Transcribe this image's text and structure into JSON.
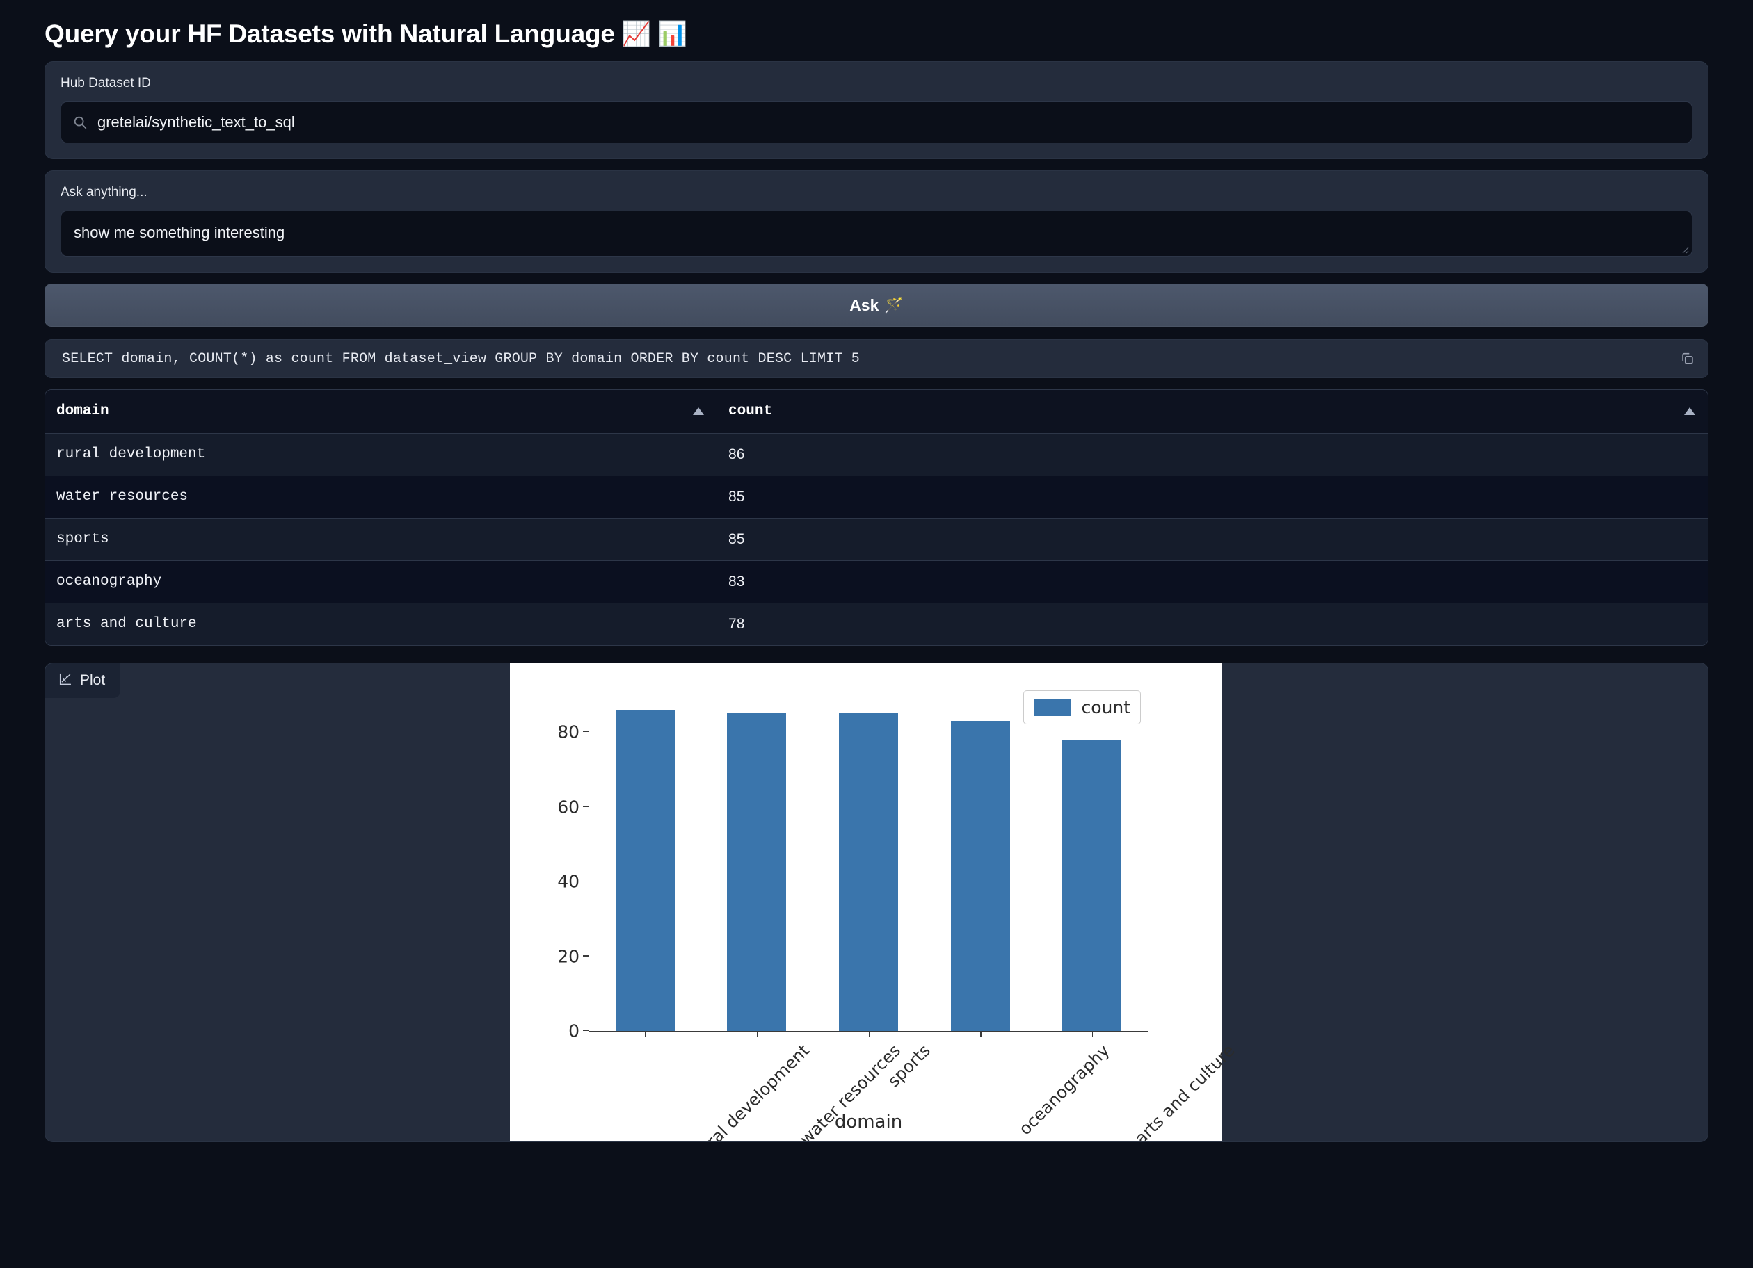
{
  "header": {
    "title": "Query your HF Datasets with Natural Language",
    "emoji_chart_increasing": "📈",
    "emoji_bar_chart": "📊"
  },
  "dataset_field": {
    "label": "Hub Dataset ID",
    "value": "gretelai/synthetic_text_to_sql",
    "placeholder": "Hub Dataset ID",
    "icon": "search-icon"
  },
  "query_field": {
    "label": "Ask anything...",
    "value": "show me something interesting",
    "placeholder": "Ask anything..."
  },
  "ask_button": {
    "label": "Ask",
    "emoji": "🪄"
  },
  "sql": {
    "text": "SELECT domain, COUNT(*) as count FROM dataset_view GROUP BY domain ORDER BY count DESC LIMIT 5",
    "copy_icon": "copy-icon"
  },
  "table": {
    "columns": [
      {
        "label": "domain",
        "sort": "ascending"
      },
      {
        "label": "count",
        "sort": "ascending"
      }
    ],
    "rows": [
      {
        "domain": "rural development",
        "count": "86"
      },
      {
        "domain": "water resources",
        "count": "85"
      },
      {
        "domain": "sports",
        "count": "85"
      },
      {
        "domain": "oceanography",
        "count": "83"
      },
      {
        "domain": "arts and culture",
        "count": "78"
      }
    ]
  },
  "plot_panel": {
    "tab_label": "Plot",
    "tab_icon": "plot-icon"
  },
  "colors": {
    "page_background": "#0b0f19",
    "panel_background": "#242c3c",
    "input_background": "#0b0f19",
    "bar_blue": "#3a75ac",
    "button_gradient_top": "#4d586c",
    "button_gradient_bottom": "#424c5e",
    "row_odd": "#151c2b",
    "row_even": "#0b1020"
  },
  "chart_data": {
    "type": "bar",
    "title": "",
    "categories": [
      "rural development",
      "water resources",
      "sports",
      "oceanography",
      "arts and culture"
    ],
    "values": [
      86,
      85,
      85,
      83,
      78
    ],
    "series": [
      {
        "name": "count",
        "values": [
          86,
          85,
          85,
          83,
          78
        ]
      }
    ],
    "xlabel": "domain",
    "ylabel": "",
    "ylim": [
      0,
      93
    ],
    "yticks": [
      0,
      20,
      40,
      60,
      80
    ],
    "ytick_labels": [
      "0",
      "20",
      "40",
      "60",
      "80"
    ],
    "legend": {
      "entries": [
        "count"
      ],
      "position": "upper right"
    },
    "grid": false,
    "xtick_rotation": -45,
    "bar_color": "#3a75ac"
  }
}
